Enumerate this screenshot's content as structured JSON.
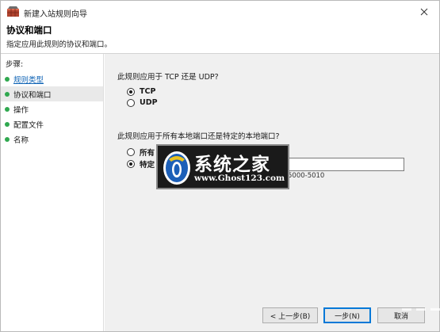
{
  "window": {
    "title": "新建入站规则向导",
    "app_icon": "firewall-shield-icon",
    "close_icon": "close-icon"
  },
  "header": {
    "title": "协议和端口",
    "subtitle": "指定应用此规则的协议和端口。"
  },
  "sidebar": {
    "title": "步骤:",
    "items": [
      {
        "label": "规则类型",
        "state": "done",
        "dot_color": "#2fa84f"
      },
      {
        "label": "协议和端口",
        "state": "current",
        "dot_color": "#2fa84f"
      },
      {
        "label": "操作",
        "state": "pending",
        "dot_color": "#2fa84f"
      },
      {
        "label": "配置文件",
        "state": "pending",
        "dot_color": "#2fa84f"
      },
      {
        "label": "名称",
        "state": "pending",
        "dot_color": "#2fa84f"
      }
    ]
  },
  "protocol": {
    "question": "此规则应用于 TCP 还是 UDP?",
    "options": [
      {
        "label": "TCP",
        "selected": true
      },
      {
        "label": "UDP",
        "selected": false
      }
    ]
  },
  "ports": {
    "question": "此规则应用于所有本地端口还是特定的本地端口?",
    "options": [
      {
        "label": "所有",
        "selected": false
      },
      {
        "label": "特定",
        "selected": true
      }
    ],
    "input_value": "",
    "example": "5000-5010"
  },
  "watermark": {
    "name": "系统之家",
    "url": "www.Ghost123.com"
  },
  "buttons": {
    "back": "< 上一步(B)",
    "next": "一步(N)",
    "cancel": "取消"
  },
  "colors": {
    "accent": "#0078d7",
    "link": "#0e63b5",
    "step_dot": "#2fa84f",
    "content_bg": "#f0f0f0"
  }
}
